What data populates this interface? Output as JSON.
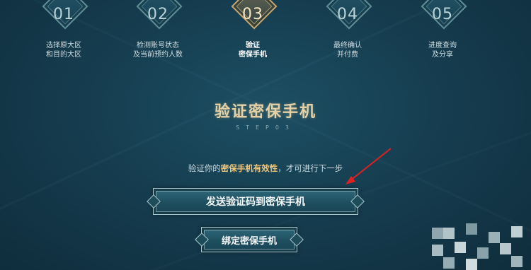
{
  "steps": [
    {
      "num": "01",
      "label": "选择原大区\n和目的大区"
    },
    {
      "num": "02",
      "label": "检测账号状态\n及当前预约人数"
    },
    {
      "num": "03",
      "label": "验证\n密保手机"
    },
    {
      "num": "04",
      "label": "最终确认\n并付费"
    },
    {
      "num": "05",
      "label": "进度查询\n及分享"
    }
  ],
  "active_step": 3,
  "section": {
    "title": "验证密保手机",
    "subtitle": "STEP03"
  },
  "description": {
    "prefix": "验证你的",
    "highlight": "密保手机有效性",
    "suffix": "，才可进行下一步"
  },
  "buttons": {
    "send_code": "发送验证码到密保手机",
    "bind_phone": "绑定密保手机"
  },
  "colors": {
    "highlight": "#f2c77a",
    "active_step_border": "#c8a66b",
    "arrow": "#e02020"
  }
}
